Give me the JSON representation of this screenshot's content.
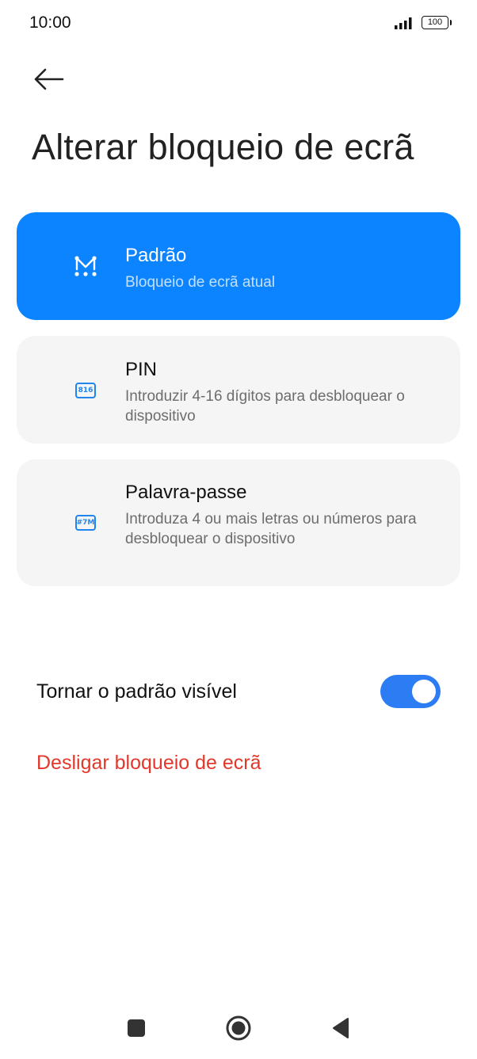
{
  "status_bar": {
    "time": "10:00",
    "battery": "100",
    "signal_icon": "signal-bars-icon",
    "battery_icon": "battery-icon"
  },
  "header": {
    "back_icon": "arrow-left-icon",
    "title": "Alterar bloqueio de ecrã"
  },
  "options": [
    {
      "title": "Padrão",
      "description": "Bloqueio de ecrã atual",
      "icon": "pattern-icon",
      "selected": true
    },
    {
      "title": "PIN",
      "description": "Introduzir 4-16 dígitos para desbloquear o dispositivo",
      "icon": "pin-icon",
      "icon_text": "816",
      "selected": false
    },
    {
      "title": "Palavra-passe",
      "description": "Introduza 4 ou mais letras ou números para desbloquear o dispositivo",
      "icon": "password-icon",
      "icon_text": "#7M",
      "selected": false
    }
  ],
  "settings": {
    "visible_pattern_label": "Tornar o padrão visível",
    "visible_pattern_on": true,
    "turn_off_label": "Desligar bloqueio de ecrã"
  },
  "navigation": {
    "recents_icon": "square-icon",
    "home_icon": "circle-icon",
    "back_icon": "triangle-back-icon"
  },
  "colors": {
    "accent": "#0d84ff",
    "toggle_on": "#2c7df4",
    "danger": "#e2382b",
    "card_bg": "#f5f5f5"
  }
}
